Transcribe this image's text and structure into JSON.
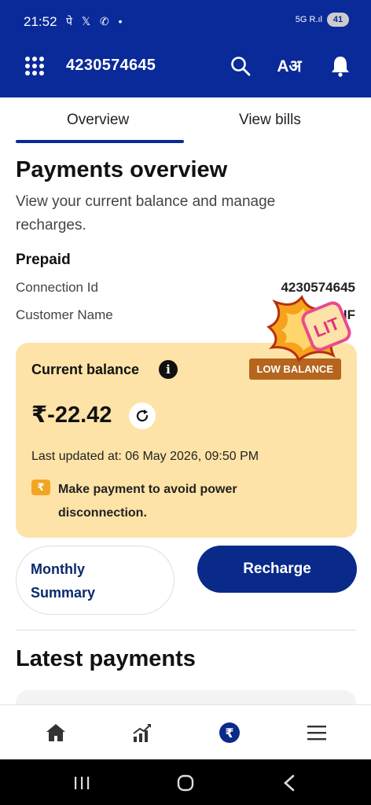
{
  "status_bar": {
    "time": "21:52",
    "notification_icons": "पे 𝕏 ✆ •",
    "network": "5G R.ıl",
    "battery": "41"
  },
  "app_bar": {
    "title": "4230574645",
    "icons": [
      "grid-menu-icon",
      "search-icon",
      "font-size-icon",
      "bell-icon"
    ],
    "font_icon_text": "Aअ"
  },
  "tabs": [
    {
      "label": "Overview",
      "active": true
    },
    {
      "label": "View bills",
      "active": false
    }
  ],
  "overview": {
    "heading": "Payments overview",
    "description": "View your current balance and manage recharges.",
    "section": "Prepaid",
    "connection_label": "Connection Id",
    "connection_value": "4230574645",
    "customer_label": "Customer Name",
    "customer_value": "...IF"
  },
  "balance_card": {
    "label": "Current balance",
    "badge": "LOW BALANCE",
    "amount": "₹-22.42",
    "last_updated": "Last updated at: 06 May 2026, 09:50 PM",
    "warning": "Make payment to avoid power disconnection.",
    "colors": {
      "card_bg": "#fde3a7",
      "badge_bg": "#b5651d"
    }
  },
  "sticker": {
    "text": "LIT"
  },
  "buttons": {
    "monthly_summary": "Monthly Summary",
    "recharge": "Recharge"
  },
  "latest": {
    "heading": "Latest payments"
  },
  "bottom_nav": [
    "home-icon",
    "chart-icon",
    "rupee-icon",
    "menu-icon"
  ],
  "colors": {
    "primary": "#0a2a9a",
    "accent_text": "#0a2a6a"
  }
}
